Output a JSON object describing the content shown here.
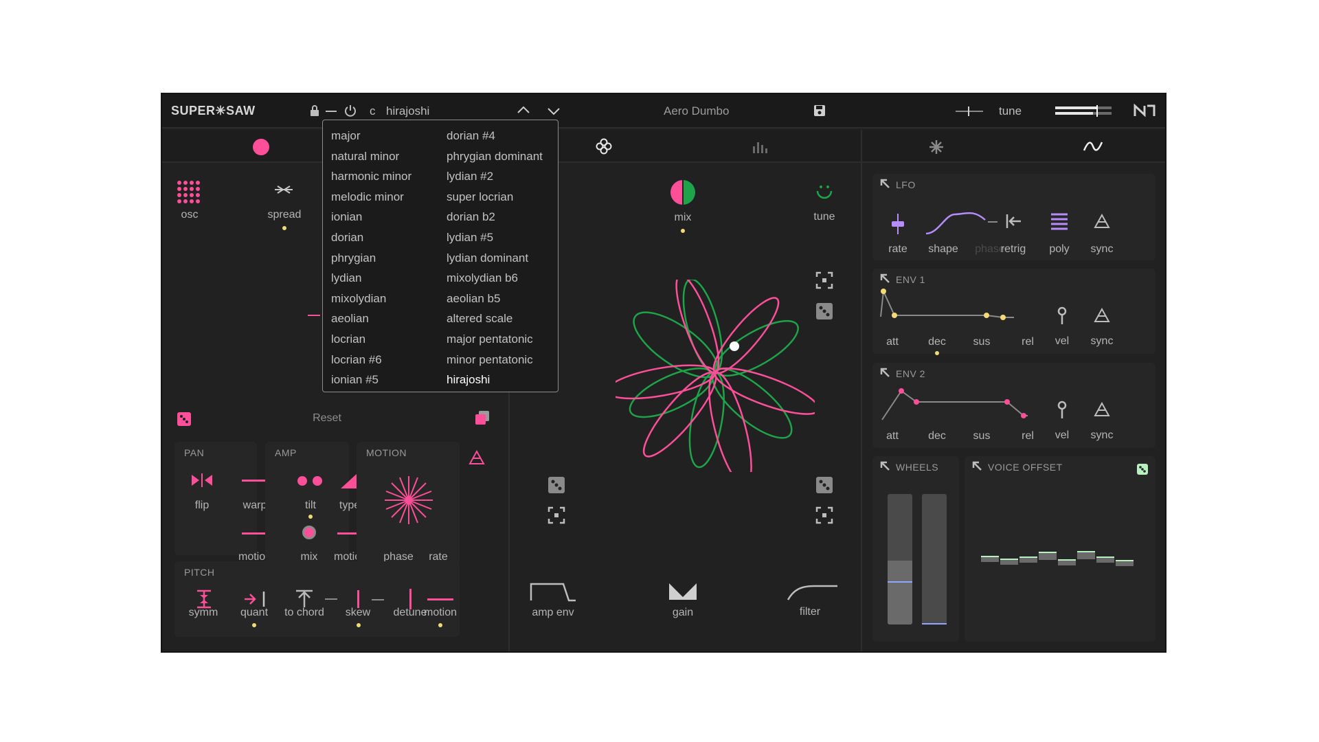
{
  "header": {
    "logo": "SUPER✳SAW",
    "key": "c",
    "scale": "hirajoshi",
    "preset": "Aero Dumbo",
    "tune": "tune"
  },
  "scale_menu": {
    "left": [
      "major",
      "natural minor",
      "harmonic minor",
      "melodic minor",
      "ionian",
      "dorian",
      "phrygian",
      "lydian",
      "mixolydian",
      "aeolian",
      "locrian",
      "locrian #6",
      "ionian #5"
    ],
    "right": [
      "dorian #4",
      "phrygian dominant",
      "lydian #2",
      "super locrian",
      "dorian b2",
      "lydian #5",
      "lydian dominant",
      "mixolydian b6",
      "aeolian b5",
      "altered scale",
      "major pentatonic",
      "minor pentatonic",
      "hirajoshi"
    ],
    "selected": "hirajoshi"
  },
  "left": {
    "osc": "osc",
    "spread": "spread",
    "reset": "Reset",
    "pan": {
      "title": "PAN",
      "flip": "flip",
      "warp": "warp",
      "motion": "motion"
    },
    "amp": {
      "title": "AMP",
      "tilt": "tilt",
      "type": "type",
      "mix": "mix",
      "motion": "motion"
    },
    "motion": {
      "title": "MOTION",
      "phase": "phase",
      "rate": "rate"
    },
    "pitch": {
      "title": "PITCH",
      "symm": "symm",
      "quant": "quant",
      "to_chord": "to chord",
      "skew": "skew",
      "detune": "detune",
      "motion": "motion"
    }
  },
  "center": {
    "mix": "mix",
    "tune": "tune",
    "amp_env": "amp env",
    "gain": "gain",
    "filter": "filter"
  },
  "right": {
    "lfo": {
      "title": "LFO",
      "rate": "rate",
      "shape": "shape",
      "phase": "phase",
      "retrig": "retrig",
      "poly": "poly",
      "sync": "sync"
    },
    "env1": {
      "title": "ENV 1",
      "att": "att",
      "dec": "dec",
      "sus": "sus",
      "rel": "rel",
      "vel": "vel",
      "sync": "sync"
    },
    "env2": {
      "title": "ENV 2",
      "att": "att",
      "dec": "dec",
      "sus": "sus",
      "rel": "rel",
      "vel": "vel",
      "sync": "sync"
    },
    "wheels": {
      "title": "WHEELS",
      "levels": [
        0.5,
        0.0
      ]
    },
    "voice_offset": {
      "title": "VOICE OFFSET"
    }
  },
  "colors": {
    "accent": "#ff4f98",
    "green": "#1fa34a",
    "dot": "#f3da76",
    "lfo": "#b78cff"
  }
}
